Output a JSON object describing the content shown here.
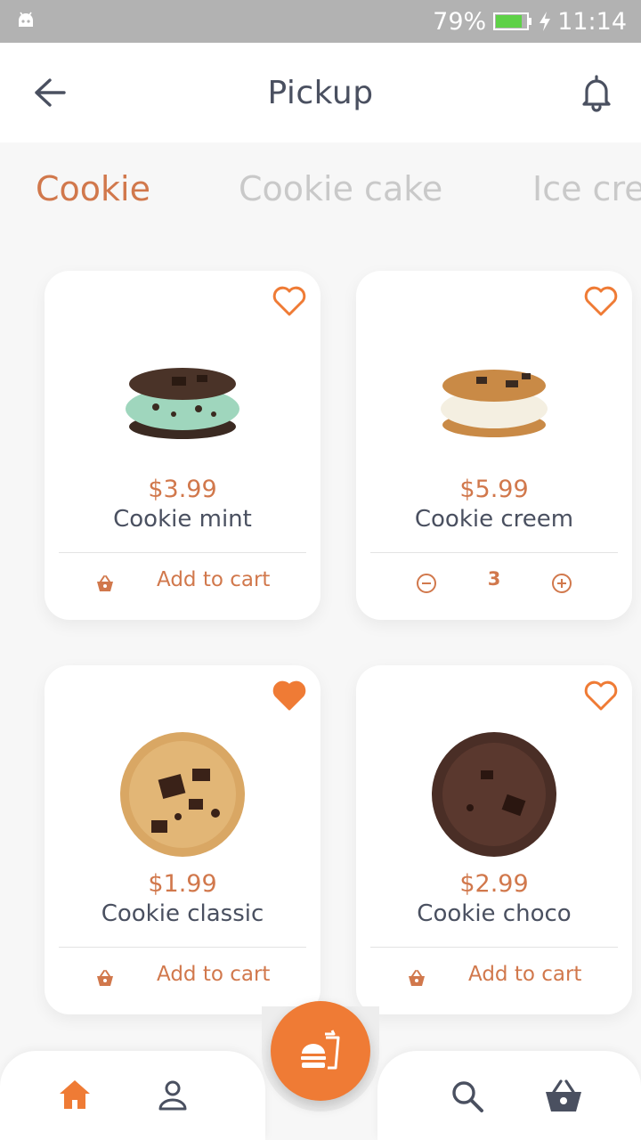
{
  "status_bar": {
    "battery": "79%",
    "time": "11:14"
  },
  "app_bar": {
    "title": "Pickup",
    "back_icon": "arrow-left-icon",
    "bell_icon": "bell-icon"
  },
  "tabs": [
    {
      "label": "Cookie",
      "active": true
    },
    {
      "label": "Cookie cake",
      "active": false
    },
    {
      "label": "Ice cre",
      "active": false
    }
  ],
  "products": [
    {
      "price": "$3.99",
      "name": "Cookie mint",
      "favorite": false,
      "action": "Add to cart"
    },
    {
      "price": "$5.99",
      "name": "Cookie creem",
      "favorite": false,
      "quantity": "3"
    },
    {
      "price": "$1.99",
      "name": "Cookie classic",
      "favorite": true,
      "action": "Add to cart"
    },
    {
      "price": "$2.99",
      "name": "Cookie choco",
      "favorite": false,
      "action": "Add to cart"
    }
  ],
  "bottom_nav": {
    "items": [
      "home-icon",
      "profile-icon",
      "search-icon",
      "basket-icon"
    ],
    "fab_icon": "burger-drink-icon",
    "active": "home-icon"
  },
  "colors": {
    "accent": "#ef7b35",
    "price": "#d1784c",
    "text": "#4a5060",
    "inactive_tab": "#c9c9c9"
  }
}
